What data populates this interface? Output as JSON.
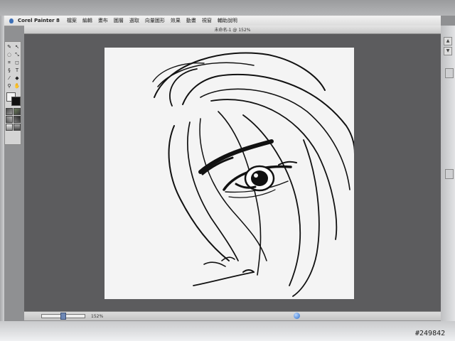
{
  "menubar": {
    "app_name": "Corel Painter 8",
    "items": [
      "檔案",
      "編輯",
      "畫布",
      "圖層",
      "選取",
      "向量圖形",
      "效果",
      "動畫",
      "視窗",
      "輔助說明"
    ]
  },
  "document": {
    "title": "未命名-1 @ 152%"
  },
  "toolbox": {
    "tools": [
      "brush-tool-icon",
      "layer-adjuster-icon",
      "lasso-icon",
      "transform-icon",
      "crop-icon",
      "shape-icon",
      "pen-icon",
      "text-icon",
      "dropper-icon",
      "paint-bucket-icon",
      "magnifier-icon",
      "grabber-icon"
    ],
    "primary_color": "#f4f4f4",
    "secondary_color": "#111111"
  },
  "statusbar": {
    "zoom": "152%"
  },
  "watermark": "#249842",
  "colors": {
    "workspace": "#5c5c5e",
    "canvas": "#f4f4f4",
    "ink": "#111111"
  }
}
